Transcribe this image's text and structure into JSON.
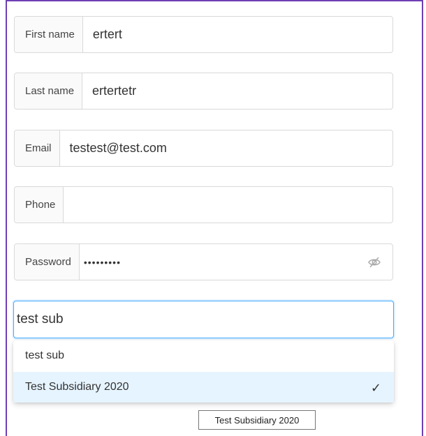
{
  "form": {
    "first_name": {
      "label": "First name",
      "value": "ertert"
    },
    "last_name": {
      "label": "Last name",
      "value": "ertertetr"
    },
    "email": {
      "label": "Email",
      "value": "testest@test.com"
    },
    "phone": {
      "label": "Phone",
      "value": ""
    },
    "password": {
      "label": "Password",
      "value": "•••••••••",
      "toggle_icon": "eye-slash-icon"
    }
  },
  "subsidiary": {
    "search_value": "test sub",
    "options": [
      {
        "label": "test sub",
        "selected": false
      },
      {
        "label": "Test Subsidiary 2020",
        "selected": true
      }
    ],
    "check_icon": "checkmark-icon"
  },
  "tooltip": {
    "text": "Test Subsidiary 2020"
  },
  "colors": {
    "focus_border": "#40a9ff",
    "selected_bg": "#e6f4ff",
    "frame": "#6f3fb5"
  }
}
